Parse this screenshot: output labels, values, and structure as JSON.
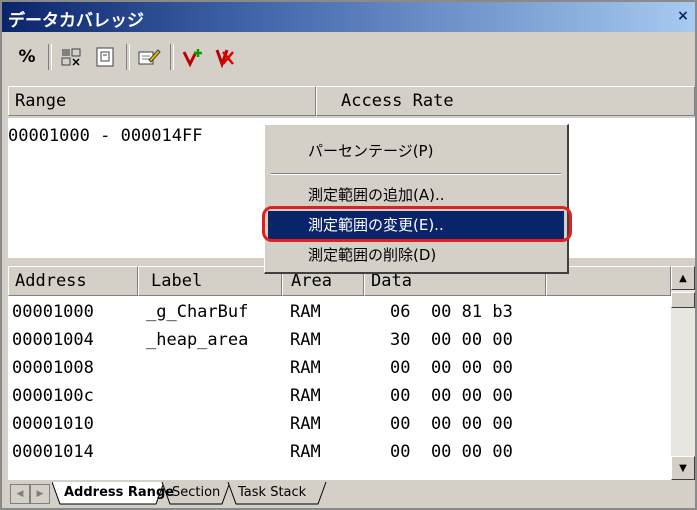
{
  "window": {
    "title": "データカバレッジ",
    "close_glyph": "×"
  },
  "toolbar": {
    "percent_label": "%",
    "icons": [
      "percent-icon",
      "filter-icon",
      "document-icon",
      "edit-icon",
      "add-range-icon",
      "delete-range-icon"
    ]
  },
  "range_table": {
    "headers": [
      "Range",
      "Access Rate"
    ],
    "rows": [
      {
        "range": "00001000 - 000014FF",
        "rate": ""
      }
    ]
  },
  "context_menu": {
    "items": [
      {
        "label": "パーセンテージ(P)",
        "selected": false
      },
      {
        "label": "測定範囲の追加(A)..",
        "selected": false
      },
      {
        "label": "測定範囲の変更(E)..",
        "selected": true
      },
      {
        "label": "測定範囲の削除(D)",
        "selected": false
      }
    ]
  },
  "detail_table": {
    "headers": [
      "Address",
      "Label",
      "Area",
      "Data"
    ],
    "rows": [
      {
        "address": "00001000",
        "label": "_g_CharBuf",
        "area": "RAM",
        "data": "06  00 81 b3"
      },
      {
        "address": "00001004",
        "label": "_heap_area",
        "area": "RAM",
        "data": "30  00 00 00"
      },
      {
        "address": "00001008",
        "label": "",
        "area": "RAM",
        "data": "00  00 00 00"
      },
      {
        "address": "0000100c",
        "label": "",
        "area": "RAM",
        "data": "00  00 00 00"
      },
      {
        "address": "00001010",
        "label": "",
        "area": "RAM",
        "data": "00  00 00 00"
      },
      {
        "address": "00001014",
        "label": "",
        "area": "RAM",
        "data": "00  00 00 00"
      }
    ]
  },
  "tabs": {
    "items": [
      "Address Range",
      "Section",
      "Task Stack"
    ],
    "active": "Address Range"
  },
  "colors": {
    "title_start": "#0a246a",
    "selection": "#0a246a",
    "highlight_ring": "#e02020"
  }
}
